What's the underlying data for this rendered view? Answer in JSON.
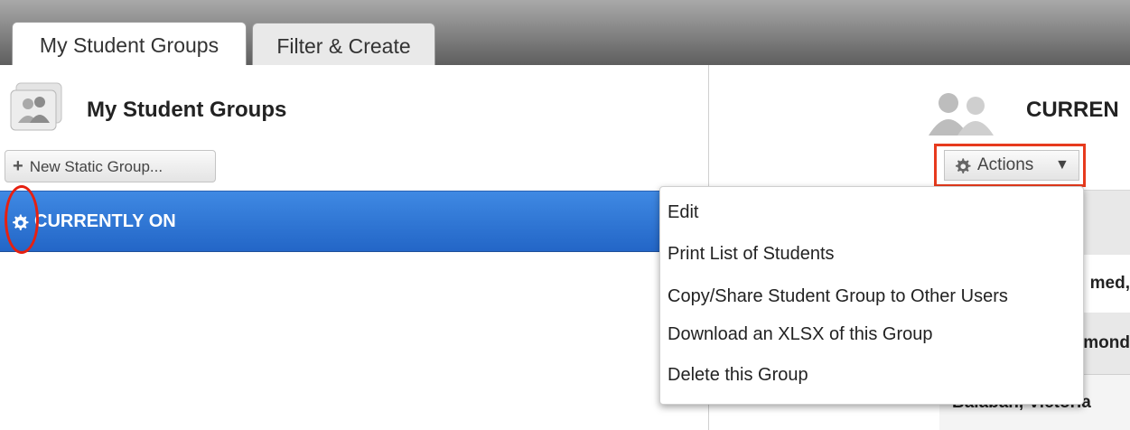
{
  "tabs": [
    {
      "label": "My Student Groups",
      "active": true
    },
    {
      "label": "Filter & Create",
      "active": false
    }
  ],
  "left_panel": {
    "title": "My Student Groups",
    "icon": "group-icon",
    "new_group_button": {
      "icon": "plus-icon",
      "label": "New Static Group..."
    },
    "groups": [
      {
        "icon": "gear-icon",
        "label": "CURRENTLY ON",
        "selected": true
      }
    ]
  },
  "right_panel": {
    "title": "CURREN",
    "icon": "people-icon",
    "actions_button": {
      "icon": "gear-icon",
      "label": "Actions",
      "caret": "▼"
    },
    "actions_menu": [
      "Edit",
      "Print List of Students",
      "Copy/Share Student Group to Other Users",
      "Download an XLSX of this Group",
      "Delete this Group"
    ],
    "table_rows_visible": [
      "",
      "med,",
      "mond",
      "Balaban, Victoria"
    ]
  },
  "colors": {
    "selected_row": "#2f77d6",
    "highlight_red": "#e62010",
    "tab_bar_dark": "#5e5e5e"
  }
}
